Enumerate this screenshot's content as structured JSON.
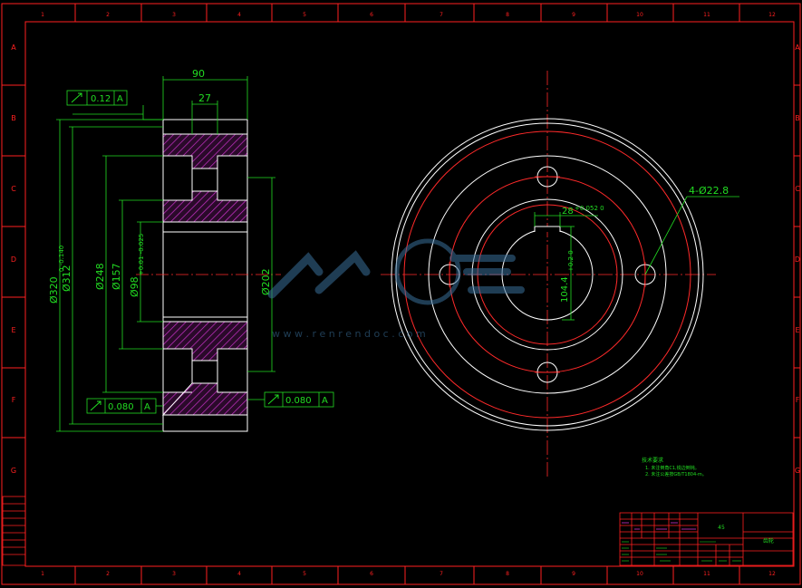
{
  "frame": {
    "col_labels": [
      "1",
      "2",
      "3",
      "4",
      "5",
      "6",
      "7",
      "8",
      "9",
      "10",
      "11",
      "12"
    ],
    "row_labels": [
      "A",
      "B",
      "C",
      "D",
      "E",
      "F",
      "G"
    ]
  },
  "section_view": {
    "width_dim": "90",
    "hub_dim": "27",
    "tol_top": "0.12",
    "tol_datum": "A",
    "tol_bottom_left": "0.080",
    "tol_bottom_right": "0.080",
    "dia_outer": "Ø320",
    "dia_outer_tol": "0 -0.140",
    "dia_312": "Ø312",
    "dia_248": "Ø248",
    "dia_157": "Ø157",
    "dia_98": "Ø98",
    "dia_98_tol": "+0.01 -0.025",
    "dia_202": "Ø202"
  },
  "front_view": {
    "holes_label": "4-Ø22.8",
    "key_width": "28",
    "key_width_tol": "+0.052 0",
    "key_depth": "104.4",
    "key_depth_tol": "+0.2 0"
  },
  "watermark": {
    "url": "w w w . r e n r e n d o c . c o m"
  },
  "notes": {
    "title": "技术要求",
    "line1": "1. 未注倒角C1,锐边倒钝。",
    "line2": "2. 未注公差按GB/T1804-m。"
  },
  "title_block": {
    "material": "45",
    "name": "齿轮"
  },
  "colors": {
    "frame": "#ff2020",
    "geometry": "#ffffff",
    "centerline": "#ff2a2a",
    "dimension": "#22dd22",
    "hatch": "#cc33cc",
    "watermark": "#3a6f9a"
  }
}
